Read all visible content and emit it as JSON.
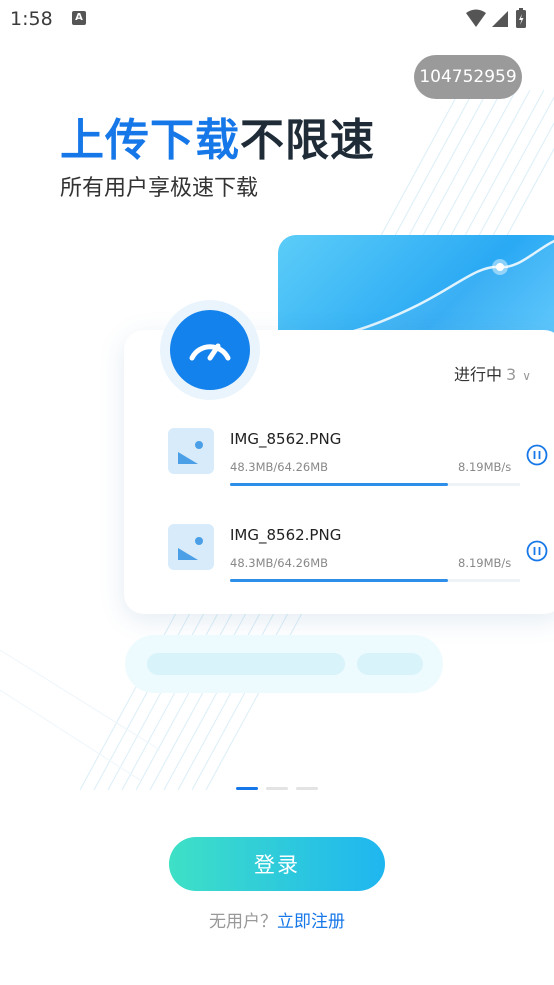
{
  "status_bar": {
    "time": "1:58",
    "notification_icon": "A"
  },
  "user_id_badge": "104752959",
  "hero": {
    "title_blue": "上传下载",
    "title_dark": "不限速",
    "subtitle": "所有用户享极速下载"
  },
  "task_card": {
    "filter_label": "进行中",
    "filter_count": "3",
    "items": [
      {
        "filename": "IMG_8562.PNG",
        "size": "48.3MB/64.26MB",
        "speed": "8.19MB/s",
        "progress": 0.75
      },
      {
        "filename": "IMG_8562.PNG",
        "size": "48.3MB/64.26MB",
        "speed": "8.19MB/s",
        "progress": 0.75
      }
    ]
  },
  "pager": {
    "active_index": 0,
    "count": 3
  },
  "login_button": "登录",
  "register": {
    "prompt": "无用户？",
    "link": "立即注册"
  },
  "colors": {
    "accent_blue": "#1677e8",
    "button_gradient_start": "#3ee0c6",
    "button_gradient_end": "#1fb6f0"
  }
}
